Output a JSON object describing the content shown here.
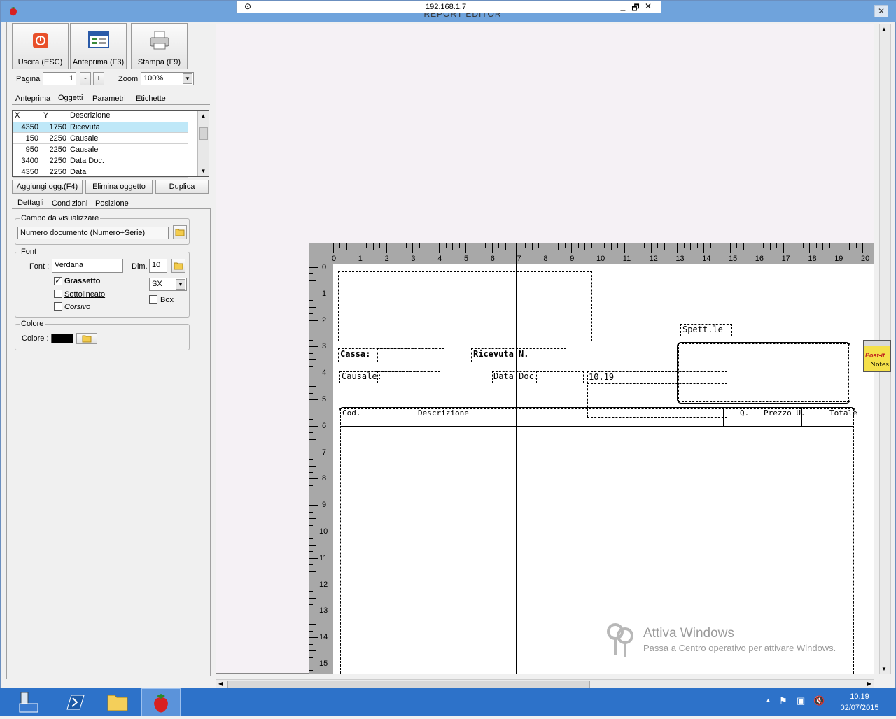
{
  "window": {
    "title": "REPORT EDITOR",
    "close_glyph": "✕"
  },
  "remote_bar": {
    "ip": "192.168.1.7",
    "pin_icon": "pin-icon",
    "minimize": "_",
    "restore": "🗗",
    "close": "✕"
  },
  "toolbar": {
    "exit_label": "Uscita (ESC)",
    "preview_label": "Anteprima (F3)",
    "print_label": "Stampa (F9)"
  },
  "paging": {
    "page_label": "Pagina",
    "page_value": "1",
    "minus": "-",
    "plus": "+",
    "zoom_label": "Zoom",
    "zoom_value": "100%"
  },
  "top_tabs": [
    "Anteprima",
    "Oggetti",
    "Parametri",
    "Etichette"
  ],
  "objects_table": {
    "columns": [
      "X",
      "Y",
      "Descrizione"
    ],
    "rows": [
      {
        "x": "4350",
        "y": "1750",
        "desc": "Ricevuta"
      },
      {
        "x": "150",
        "y": "2250",
        "desc": "Causale"
      },
      {
        "x": "950",
        "y": "2250",
        "desc": "Causale"
      },
      {
        "x": "3400",
        "y": "2250",
        "desc": "Data Doc."
      },
      {
        "x": "4350",
        "y": "2250",
        "desc": "Data"
      }
    ]
  },
  "object_buttons": {
    "add": "Aggiungi ogg.(F4)",
    "delete": "Elimina oggetto",
    "duplicate": "Duplica"
  },
  "detail_tabs": [
    "Dettagli",
    "Condizioni",
    "Posizione"
  ],
  "field_group": {
    "legend": "Campo da visualizzare",
    "value": "Numero documento (Numero+Serie)"
  },
  "font_group": {
    "legend": "Font",
    "font_label": "Font :",
    "font_value": "Verdana",
    "dim_label": "Dim.",
    "dim_value": "10",
    "bold_label": "Grassetto",
    "underline_label": "Sottolineato",
    "italic_label": "Corsivo",
    "align_value": "SX",
    "box_label": "Box",
    "bold_checked": "✓"
  },
  "color_group": {
    "legend": "Colore",
    "label": "Colore :",
    "color": "#000000"
  },
  "ruler": {
    "top": [
      "0",
      "1",
      "2",
      "3",
      "4",
      "5",
      "6",
      "7",
      "8",
      "9",
      "10",
      "11",
      "12",
      "13",
      "14",
      "15",
      "16",
      "17",
      "18",
      "19",
      "20"
    ],
    "left": [
      "0",
      "1",
      "2",
      "3",
      "4",
      "5",
      "6",
      "7",
      "8",
      "9",
      "10",
      "11",
      "12",
      "13",
      "14",
      "15"
    ]
  },
  "report": {
    "spett": "Spett.le",
    "cassa": "Cassa:",
    "ricevuta": "Ricevuta N.",
    "causale": "Causale:",
    "data_doc": "Data Doc.",
    "time_value": "10.19",
    "col_cod": "Cod.",
    "col_desc": "Descrizione",
    "col_q": "Q.",
    "col_prezzo": "Prezzo U.",
    "col_totale": "Totale"
  },
  "postit": {
    "line1": "Post-it",
    "line2": "Notes"
  },
  "watermark": {
    "title": "Attiva Windows",
    "subtitle": "Passa a Centro operativo per attivare Windows."
  },
  "taskbar": {
    "time": "10.19",
    "date": "02/07/2015"
  },
  "colors": {
    "accent": "#2d72c9",
    "titlebar": "#6fa3dc",
    "selected_row": "#bfe8f8"
  }
}
